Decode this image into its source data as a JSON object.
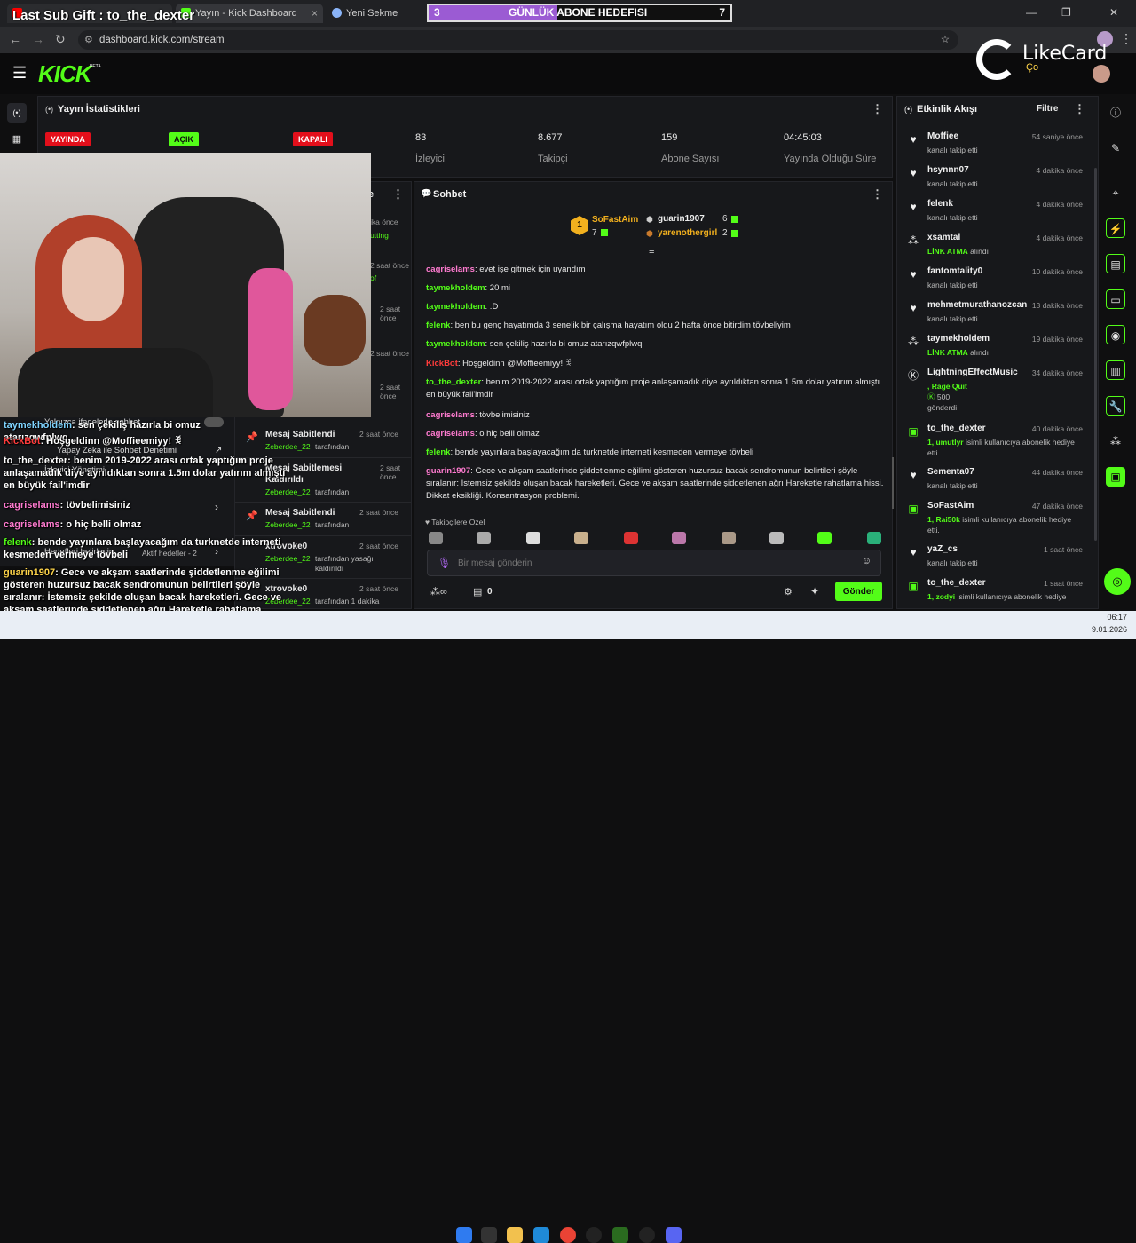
{
  "browser": {
    "tabs": [
      {
        "label": "Yayın - Kick Dashboard",
        "close": "×"
      },
      {
        "label": "Yeni Sekme",
        "close": "×"
      }
    ],
    "address": "dashboard.kick.com/stream",
    "new_tab": "+",
    "window_controls": [
      "—",
      "❐",
      "✕"
    ]
  },
  "overlay": {
    "last_sub": "Last Sub Gift : to_the_dexter",
    "goal_left": "3",
    "goal_title": "GÜNLÜK ABONE HEDEFISI",
    "goal_right": "7",
    "brand": "LikeCard",
    "brand_sub": "Ço",
    "chat": [
      {
        "user": "taymekholdem",
        "text": ": sen çekiliş hazırla bi omuz atarızqwfplwq",
        "color": "#7fd4ff"
      },
      {
        "user": "KickBot",
        "text": ": Hoşgeldinn @Moffieemiyy! ꉂ",
        "color": "#ff3b3b"
      },
      {
        "user": "to_the_dexter",
        "text": ": benim 2019-2022 arası ortak yaptığım proje anlaşamadık diye ayrıldıktan sonra 1.5m dolar yatırım almıştı en büyük fail'imdir",
        "color": "#ffffff"
      },
      {
        "user": "cagriselams",
        "text": ": tövbelimisiniz",
        "color": "#ff7bd0"
      },
      {
        "user": "cagriselams",
        "text": ": o hiç belli olmaz",
        "color": "#ff7bd0"
      },
      {
        "user": "felenk",
        "text": ": bende yayınlara başlayacağım da turknetde interneti kesmeden vermeye tövbeli",
        "color": "#53fc18"
      },
      {
        "user": "guarin1907",
        "text": ": Gece ve akşam saatlerinde şiddetlenme eğilimi gösteren huzursuz bacak sendromunun belirtileri şöyle sıralanır: İstemsiz şekilde oluşan bacak hareketleri. Gece ve akşam saatlerinde şiddetlenen ağrı Hareketle rahatlama hissi. Dikkat eksikliği. Konsantrasyon problemi.",
        "color": "#ffd54a"
      }
    ]
  },
  "kick": {
    "logo": "KICK",
    "logo_sup": "BETA",
    "stats": {
      "title": "Yayın İstatistikleri",
      "badges": [
        "YAYINDA",
        "AÇIK",
        "KAPALI"
      ],
      "items": [
        {
          "value": "83",
          "label": "İzleyici"
        },
        {
          "value": "8.677",
          "label": "Takipçi"
        },
        {
          "value": "159",
          "label": "Abone Sayısı"
        },
        {
          "value": "04:45:03",
          "label": "Yayında Olduğu Süre"
        }
      ]
    },
    "mod": {
      "items": [
        {
          "title": "Mesaj Sabitlendi",
          "by": "Zeberdee_22",
          "suffix": "tarafından",
          "time": "2 saat önce"
        },
        {
          "title": "Mesaj Sabitlemesi",
          "sub": "Kaldırıldı",
          "by": "Zeberdee_22",
          "suffix": "tarafından",
          "time": "2 saat önce"
        },
        {
          "title": "Mesaj Sabitlendi",
          "by": "Zeberdee_22",
          "suffix": "tarafından",
          "time": "2 saat önce"
        },
        {
          "title": "xtrovoke0",
          "by": "Zeberdee_22",
          "suffix": "tarafından yasağı kaldırıldı",
          "time": "2 saat önce"
        },
        {
          "title": "xtrovoke0",
          "by": "Zeberdee_22",
          "suffix": "tarafından 1 dakika",
          "time": "2 saat önce"
        }
      ],
      "partial_times": [
        "ika önce",
        "2 saat önce",
        "2 saat önce",
        "2 saat önce",
        "2 saat önce"
      ],
      "partial_texts": [
        "utting",
        "of"
      ],
      "settings": [
        {
          "label": "Yalnızca ifadelerle sohbet"
        },
        {
          "label": "Yapay Zeka ile Sohbet Denetimi"
        },
        {
          "label": "İzleyici Yönetimi"
        },
        {
          "label": "Hedefleri belirleyin",
          "sub": "Aktif hedefler - 2"
        }
      ]
    },
    "chat": {
      "title": "Sohbet",
      "top": {
        "first": {
          "rank": "1",
          "name": "SoFastAim",
          "count": "7"
        },
        "second": {
          "name": "guarin1907",
          "count": "6"
        },
        "third": {
          "name": "yarenothergirl",
          "count": "2"
        }
      },
      "messages": [
        {
          "user": "cagriselams",
          "text": ": evet işe gitmek için uyandım",
          "color": "#ff7bd0"
        },
        {
          "user": "taymekholdem",
          "text": ": 20 mi",
          "color": "#53fc18"
        },
        {
          "user": "taymekholdem",
          "text": ": :D",
          "color": "#53fc18"
        },
        {
          "user": "felenk",
          "text": ": ben bu genç hayatımda 3 senelik bir çalışma hayatım oldu 2 hafta önce bitirdim tövbeliyim",
          "color": "#53fc18"
        },
        {
          "user": "taymekholdem",
          "text": ": sen çekiliş hazırla bi omuz atarızqwfplwq",
          "color": "#53fc18"
        },
        {
          "user": "KickBot",
          "text": ": Hoşgeldinn @Moffieemiyy! ꉂ",
          "color": "#ff3b3b"
        },
        {
          "user": "to_the_dexter",
          "text": ": benim 2019-2022 arası ortak yaptığım proje anlaşamadık diye ayrıldıktan sonra 1.5m dolar yatırım almıştı en büyük fail'imdir",
          "color": "#53fc18"
        },
        {
          "user": "cagriselams",
          "text": ": tövbelimisiniz",
          "color": "#ff7bd0"
        },
        {
          "user": "cagriselams",
          "text": ": o hiç belli olmaz",
          "color": "#ff7bd0"
        },
        {
          "user": "felenk",
          "text": ": bende yayınlara başlayacağım da turknetde interneti kesmeden vermeye tövbeli",
          "color": "#53fc18"
        },
        {
          "user": "guarin1907",
          "text": ": Gece ve akşam saatlerinde şiddetlenme eğilimi gösteren huzursuz bacak sendromunun belirtileri şöyle sıralanır: İstemsiz şekilde oluşan bacak hareketleri. Gece ve akşam saatlerinde şiddetlenen ağrı Hareketle rahatlama hissi. Dikkat eksikliği. Konsantrasyon problemi.",
          "color": "#ff7bd0"
        }
      ],
      "emote_label": "♥ Takipçilere Özel",
      "placeholder": "Bir mesaj gönderin",
      "points": "0",
      "send": "Gönder"
    },
    "activity": {
      "title": "Etkinlik Akışı",
      "filter": "Filtre",
      "events": [
        {
          "name": "Moffiee",
          "sub": "kanalı takip etti",
          "time": "54 saniye önce",
          "icon": "heart"
        },
        {
          "name": "hsynnn07",
          "sub": "kanalı takip etti",
          "time": "4 dakika önce",
          "icon": "heart"
        },
        {
          "name": "felenk",
          "sub": "kanalı takip etti",
          "time": "4 dakika önce",
          "icon": "heart"
        },
        {
          "name": "xsamtal",
          "sub_accent": "LİNK ATMA",
          "sub": "alındı",
          "time": "4 dakika önce",
          "icon": "points"
        },
        {
          "name": "fantomtality0",
          "sub": "kanalı takip etti",
          "time": "10 dakika önce",
          "icon": "heart"
        },
        {
          "name": "mehmetmurathanozcan",
          "sub": "kanalı takip etti",
          "time": "13 dakika önce",
          "icon": "heart"
        },
        {
          "name": "taymekholdem",
          "sub_accent": "LİNK ATMA",
          "sub": "alındı",
          "time": "19 dakika önce",
          "icon": "points"
        },
        {
          "name": "LightningEffectMusic",
          "sub": ", Rage Quit",
          "extra": "500",
          "extra2": "gönderdi",
          "time": "34 dakika önce",
          "icon": "kick"
        },
        {
          "name": "to_the_dexter",
          "sub_accent": "1, umutlyr",
          "sub": "isimli kullanıcıya abonelik hediye etti.",
          "time": "40 dakika önce",
          "icon": "gift"
        },
        {
          "name": "Sementa07",
          "sub": "kanalı takip etti",
          "time": "44 dakika önce",
          "icon": "heart"
        },
        {
          "name": "SoFastAim",
          "sub_accent": "1, Rai50k",
          "sub": "isimli kullanıcıya abonelik hediye etti.",
          "time": "47 dakika önce",
          "icon": "gift"
        },
        {
          "name": "yaZ_cs",
          "sub": "kanalı takip etti",
          "time": "1 saat önce",
          "icon": "heart"
        },
        {
          "name": "to_the_dexter",
          "sub_accent": "1, zodyi",
          "sub": "isimli kullanıcıya abonelik hediye",
          "time": "1 saat önce",
          "icon": "gift"
        }
      ]
    }
  },
  "taskbar": {
    "time": "06:17",
    "date": "9.01.2026"
  },
  "colors": {
    "kick_green": "#53fc18",
    "live_red": "#e30f1b",
    "bg": "#0f0f10",
    "panel": "#17181b"
  }
}
